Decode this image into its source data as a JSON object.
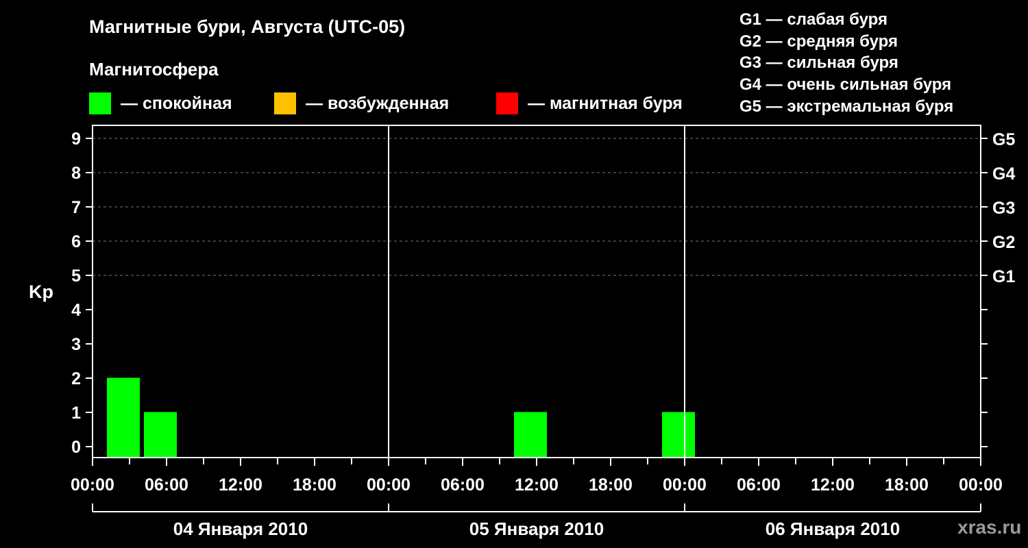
{
  "title": "Магнитные бури, Августа (UTC-05)",
  "magnetosphere_label": "Магнитосфера",
  "legend": [
    {
      "color": "#00ff00",
      "label": "— спокойная"
    },
    {
      "color": "#ffc000",
      "label": "— возбужденная"
    },
    {
      "color": "#ff0000",
      "label": "— магнитная буря"
    }
  ],
  "g_scale_legend": [
    "G1 — слабая буря",
    "G2 — средняя буря",
    "G3 — сильная буря",
    "G4 — очень сильная буря",
    "G5 — экстремальная буря"
  ],
  "site": "xras.ru",
  "chart_data": {
    "type": "bar",
    "ylabel": "Kp",
    "ylim": [
      0,
      9
    ],
    "yticks": [
      "0",
      "1",
      "2",
      "3",
      "4",
      "5",
      "6",
      "7",
      "8",
      "9"
    ],
    "right_ticks": [
      {
        "y": 5,
        "label": "G1"
      },
      {
        "y": 6,
        "label": "G2"
      },
      {
        "y": 7,
        "label": "G3"
      },
      {
        "y": 8,
        "label": "G4"
      },
      {
        "y": 9,
        "label": "G5"
      }
    ],
    "xrange_hours": [
      0,
      72
    ],
    "xtick_labels": [
      "00:00",
      "06:00",
      "12:00",
      "18:00",
      "00:00",
      "06:00",
      "12:00",
      "18:00",
      "00:00",
      "06:00",
      "12:00",
      "18:00",
      "00:00"
    ],
    "days": [
      "04 Января 2010",
      "05 Января 2010",
      "06 Января 2010"
    ],
    "grid": "dashed at Kp 5–9",
    "bars": [
      {
        "start_hour": 0,
        "value": 2,
        "color": "#00ff00"
      },
      {
        "start_hour": 3,
        "value": 1,
        "color": "#00ff00"
      },
      {
        "start_hour": 33,
        "value": 1,
        "color": "#00ff00"
      },
      {
        "start_hour": 45,
        "value": 1,
        "color": "#00ff00"
      }
    ]
  }
}
